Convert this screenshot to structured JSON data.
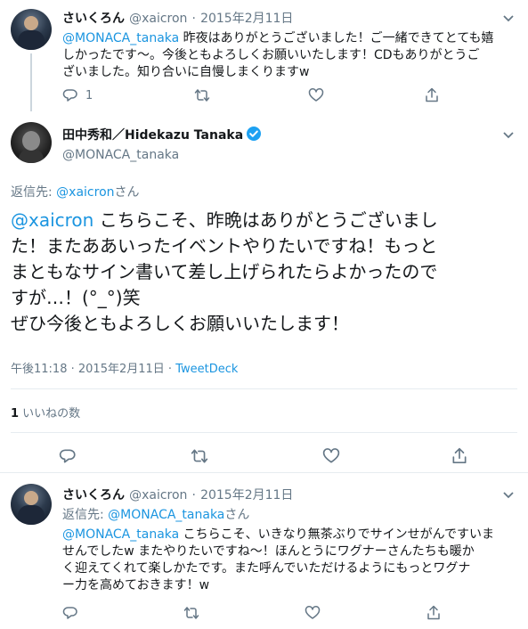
{
  "tweet1": {
    "name": "さいくろん",
    "handle": "@xaicron",
    "sep": "·",
    "date": "2015年2月11日",
    "mention": "@MONACA_tanaka",
    "body_l1": " 昨夜はありがとうございました！ご一緒できてとても嬉",
    "body_l2": "しかったです〜。今後ともよろしくお願いいたします！CDもありがとうご",
    "body_l3": "ざいました。知り合いに自慢しまくりますw",
    "reply_count": "1"
  },
  "main": {
    "name": "田中秀和／Hidekazu Tanaka",
    "handle": "@MONACA_tanaka",
    "reply_label": "返信先: ",
    "reply_to": "@xaicron",
    "reply_suffix": "さん",
    "mention": "@xaicron",
    "body_l1": " こちらこそ、昨晩はありがとうございまし",
    "body_l2": "た！またああいったイベントやりたいですね！もっと",
    "body_l3": "まともなサイン書いて差し上げられたらよかったので",
    "body_l4": "すが…！(°_°)笑",
    "body_l5": "ぜひ今後ともよろしくお願いいたします！",
    "time": "午後11:18",
    "sep": " · ",
    "date": "2015年2月11日",
    "source": "TweetDeck",
    "likes_count": "1",
    "likes_label": " いいねの数"
  },
  "tweet3": {
    "name": "さいくろん",
    "handle": "@xaicron",
    "sep": "·",
    "date": "2015年2月11日",
    "reply_label": "返信先: ",
    "reply_to": "@MONACA_tanaka",
    "reply_suffix": "さん",
    "mention": "@MONACA_tanaka",
    "body_l1": " こちらこそ、いきなり無茶ぶりでサインせがんですいま",
    "body_l2": "せんでしたw またやりたいですね〜！ほんとうにワグナーさんたちも暖か",
    "body_l3": "く迎えてくれて楽しかたです。また呼んでいただけるようにもっとワグナ",
    "body_l4": "ー力を高めておきます！w"
  },
  "colors": {
    "link": "#1b95e0",
    "verified": "#1da1f2",
    "muted": "#657786",
    "text": "#14171a"
  }
}
